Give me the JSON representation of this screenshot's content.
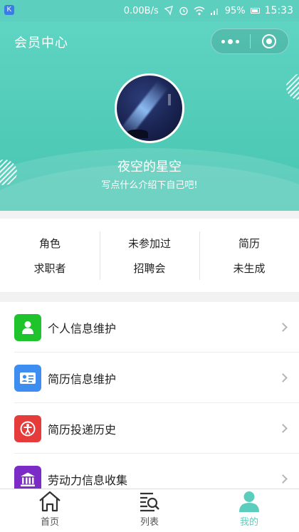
{
  "status_bar": {
    "app_badge": "K",
    "speed": "0.00B/s",
    "battery": "95%",
    "time": "15:33"
  },
  "header": {
    "title": "会员中心",
    "nickname": "夜空的星空",
    "intro": "写点什么介绍下自己吧!"
  },
  "stats": [
    {
      "top": "角色",
      "bottom": "求职者"
    },
    {
      "top": "未参加过",
      "bottom": "招聘会"
    },
    {
      "top": "简历",
      "bottom": "未生成"
    }
  ],
  "menu": [
    {
      "label": "个人信息维护",
      "color": "#1fc42d",
      "icon": "user-icon"
    },
    {
      "label": "简历信息维护",
      "color": "#3d8ef0",
      "icon": "resume-card-icon"
    },
    {
      "label": "简历投递历史",
      "color": "#e53b3b",
      "icon": "history-icon"
    },
    {
      "label": "劳动力信息收集",
      "color": "#7b2bc6",
      "icon": "bank-icon"
    }
  ],
  "tabbar": [
    {
      "label": "首页",
      "icon": "home-icon"
    },
    {
      "label": "列表",
      "icon": "list-search-icon"
    },
    {
      "label": "我的",
      "icon": "profile-icon",
      "active": true
    }
  ],
  "colors": {
    "accent": "#5bcdbd"
  }
}
